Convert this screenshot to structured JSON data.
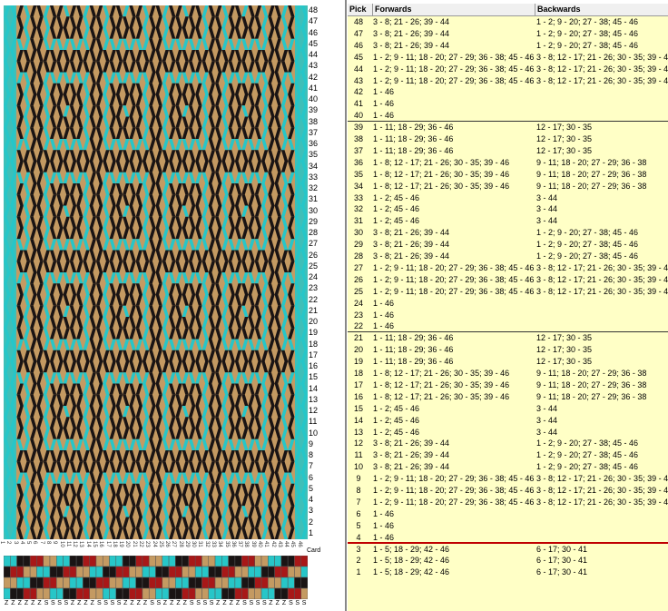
{
  "colors": {
    "turquoise": "#27c6c8",
    "tan": "#c49a62",
    "black": "#1a1414",
    "red": "#a81818",
    "panel_bg": "#ffffc6",
    "separator_red": "#c00000"
  },
  "pattern": {
    "cards": 46,
    "picks": 48,
    "row_numbers": [
      "48",
      "47",
      "46",
      "45",
      "44",
      "43",
      "42",
      "41",
      "40",
      "39",
      "38",
      "37",
      "36",
      "35",
      "34",
      "33",
      "32",
      "31",
      "30",
      "29",
      "28",
      "27",
      "26",
      "25",
      "24",
      "23",
      "22",
      "21",
      "20",
      "19",
      "18",
      "17",
      "16",
      "15",
      "14",
      "13",
      "12",
      "11",
      "10",
      "9",
      "8",
      "7",
      "6",
      "5",
      "4",
      "3",
      "2",
      "1"
    ],
    "card_label": "Card",
    "threading_directions": [
      "Z",
      "Z",
      "Z",
      "Z",
      "Z",
      "Z",
      "S",
      "S",
      "S",
      "S",
      "Z",
      "Z",
      "Z",
      "Z",
      "S",
      "S",
      "S",
      "S",
      "Z",
      "Z",
      "Z",
      "Z",
      "S",
      "S",
      "Z",
      "Z",
      "Z",
      "Z",
      "S",
      "S",
      "S",
      "S",
      "Z",
      "Z",
      "Z",
      "Z",
      "S",
      "S",
      "S",
      "S",
      "Z",
      "Z",
      "Z",
      "S",
      "S",
      "S"
    ]
  },
  "table": {
    "headers": {
      "pick": "Pick",
      "forwards": "Forwards",
      "backwards": "Backwards"
    },
    "rows": [
      {
        "pick": "48",
        "fw": "3 - 8; 21 - 26; 39 - 44",
        "bw": "1 - 2; 9 - 20; 27 - 38; 45 - 46"
      },
      {
        "pick": "47",
        "fw": "3 - 8; 21 - 26; 39 - 44",
        "bw": "1 - 2; 9 - 20; 27 - 38; 45 - 46"
      },
      {
        "pick": "46",
        "fw": "3 - 8; 21 - 26; 39 - 44",
        "bw": "1 - 2; 9 - 20; 27 - 38; 45 - 46"
      },
      {
        "pick": "45",
        "fw": "1 - 2; 9 - 11; 18 - 20; 27 - 29; 36 - 38; 45 - 46",
        "bw": "3 - 8; 12 - 17; 21 - 26; 30 - 35; 39 - 44"
      },
      {
        "pick": "44",
        "fw": "1 - 2; 9 - 11; 18 - 20; 27 - 29; 36 - 38; 45 - 46",
        "bw": "3 - 8; 12 - 17; 21 - 26; 30 - 35; 39 - 44"
      },
      {
        "pick": "43",
        "fw": "1 - 2; 9 - 11; 18 - 20; 27 - 29; 36 - 38; 45 - 46",
        "bw": "3 - 8; 12 - 17; 21 - 26; 30 - 35; 39 - 44"
      },
      {
        "pick": "42",
        "fw": "1 - 46",
        "bw": ""
      },
      {
        "pick": "41",
        "fw": "1 - 46",
        "bw": ""
      },
      {
        "pick": "40",
        "fw": "1 - 46",
        "bw": ""
      },
      {
        "pick": "39",
        "fw": "1 - 11; 18 - 29; 36 - 46",
        "bw": "12 - 17; 30 - 35"
      },
      {
        "pick": "38",
        "fw": "1 - 11; 18 - 29; 36 - 46",
        "bw": "12 - 17; 30 - 35"
      },
      {
        "pick": "37",
        "fw": "1 - 11; 18 - 29; 36 - 46",
        "bw": "12 - 17; 30 - 35"
      },
      {
        "pick": "36",
        "fw": "1 - 8; 12 - 17; 21 - 26; 30 - 35; 39 - 46",
        "bw": "9 - 11; 18 - 20; 27 - 29; 36 - 38"
      },
      {
        "pick": "35",
        "fw": "1 - 8; 12 - 17; 21 - 26; 30 - 35; 39 - 46",
        "bw": "9 - 11; 18 - 20; 27 - 29; 36 - 38"
      },
      {
        "pick": "34",
        "fw": "1 - 8; 12 - 17; 21 - 26; 30 - 35; 39 - 46",
        "bw": "9 - 11; 18 - 20; 27 - 29; 36 - 38"
      },
      {
        "pick": "33",
        "fw": "1 - 2; 45 - 46",
        "bw": "3 - 44"
      },
      {
        "pick": "32",
        "fw": "1 - 2; 45 - 46",
        "bw": "3 - 44"
      },
      {
        "pick": "31",
        "fw": "1 - 2; 45 - 46",
        "bw": "3 - 44"
      },
      {
        "pick": "30",
        "fw": "3 - 8; 21 - 26; 39 - 44",
        "bw": "1 - 2; 9 - 20; 27 - 38; 45 - 46"
      },
      {
        "pick": "29",
        "fw": "3 - 8; 21 - 26; 39 - 44",
        "bw": "1 - 2; 9 - 20; 27 - 38; 45 - 46"
      },
      {
        "pick": "28",
        "fw": "3 - 8; 21 - 26; 39 - 44",
        "bw": "1 - 2; 9 - 20; 27 - 38; 45 - 46"
      },
      {
        "pick": "27",
        "fw": "1 - 2; 9 - 11; 18 - 20; 27 - 29; 36 - 38; 45 - 46",
        "bw": "3 - 8; 12 - 17; 21 - 26; 30 - 35; 39 - 44"
      },
      {
        "pick": "26",
        "fw": "1 - 2; 9 - 11; 18 - 20; 27 - 29; 36 - 38; 45 - 46",
        "bw": "3 - 8; 12 - 17; 21 - 26; 30 - 35; 39 - 44"
      },
      {
        "pick": "25",
        "fw": "1 - 2; 9 - 11; 18 - 20; 27 - 29; 36 - 38; 45 - 46",
        "bw": "3 - 8; 12 - 17; 21 - 26; 30 - 35; 39 - 44"
      },
      {
        "pick": "24",
        "fw": "1 - 46",
        "bw": ""
      },
      {
        "pick": "23",
        "fw": "1 - 46",
        "bw": ""
      },
      {
        "pick": "22",
        "fw": "1 - 46",
        "bw": ""
      },
      {
        "pick": "21",
        "fw": "1 - 11; 18 - 29; 36 - 46",
        "bw": "12 - 17; 30 - 35"
      },
      {
        "pick": "20",
        "fw": "1 - 11; 18 - 29; 36 - 46",
        "bw": "12 - 17; 30 - 35"
      },
      {
        "pick": "19",
        "fw": "1 - 11; 18 - 29; 36 - 46",
        "bw": "12 - 17; 30 - 35"
      },
      {
        "pick": "18",
        "fw": "1 - 8; 12 - 17; 21 - 26; 30 - 35; 39 - 46",
        "bw": "9 - 11; 18 - 20; 27 - 29; 36 - 38"
      },
      {
        "pick": "17",
        "fw": "1 - 8; 12 - 17; 21 - 26; 30 - 35; 39 - 46",
        "bw": "9 - 11; 18 - 20; 27 - 29; 36 - 38"
      },
      {
        "pick": "16",
        "fw": "1 - 8; 12 - 17; 21 - 26; 30 - 35; 39 - 46",
        "bw": "9 - 11; 18 - 20; 27 - 29; 36 - 38"
      },
      {
        "pick": "15",
        "fw": "1 - 2; 45 - 46",
        "bw": "3 - 44"
      },
      {
        "pick": "14",
        "fw": "1 - 2; 45 - 46",
        "bw": "3 - 44"
      },
      {
        "pick": "13",
        "fw": "1 - 2; 45 - 46",
        "bw": "3 - 44"
      },
      {
        "pick": "12",
        "fw": "3 - 8; 21 - 26; 39 - 44",
        "bw": "1 - 2; 9 - 20; 27 - 38; 45 - 46"
      },
      {
        "pick": "11",
        "fw": "3 - 8; 21 - 26; 39 - 44",
        "bw": "1 - 2; 9 - 20; 27 - 38; 45 - 46"
      },
      {
        "pick": "10",
        "fw": "3 - 8; 21 - 26; 39 - 44",
        "bw": "1 - 2; 9 - 20; 27 - 38; 45 - 46"
      },
      {
        "pick": "9",
        "fw": "1 - 2; 9 - 11; 18 - 20; 27 - 29; 36 - 38; 45 - 46",
        "bw": "3 - 8; 12 - 17; 21 - 26; 30 - 35; 39 - 44"
      },
      {
        "pick": "8",
        "fw": "1 - 2; 9 - 11; 18 - 20; 27 - 29; 36 - 38; 45 - 46",
        "bw": "3 - 8; 12 - 17; 21 - 26; 30 - 35; 39 - 44"
      },
      {
        "pick": "7",
        "fw": "1 - 2; 9 - 11; 18 - 20; 27 - 29; 36 - 38; 45 - 46",
        "bw": "3 - 8; 12 - 17; 21 - 26; 30 - 35; 39 - 44"
      },
      {
        "pick": "6",
        "fw": "1 - 46",
        "bw": ""
      },
      {
        "pick": "5",
        "fw": "1 - 46",
        "bw": ""
      },
      {
        "pick": "4",
        "fw": "1 - 46",
        "bw": ""
      },
      {
        "pick": "3",
        "fw": "1 - 5; 18 - 29; 42 - 46",
        "bw": "6 - 17; 30 - 41"
      },
      {
        "pick": "2",
        "fw": "1 - 5; 18 - 29; 42 - 46",
        "bw": "6 - 17; 30 - 41"
      },
      {
        "pick": "1",
        "fw": "1 - 5; 18 - 29; 42 - 46",
        "bw": "6 - 17; 30 - 41"
      }
    ]
  }
}
